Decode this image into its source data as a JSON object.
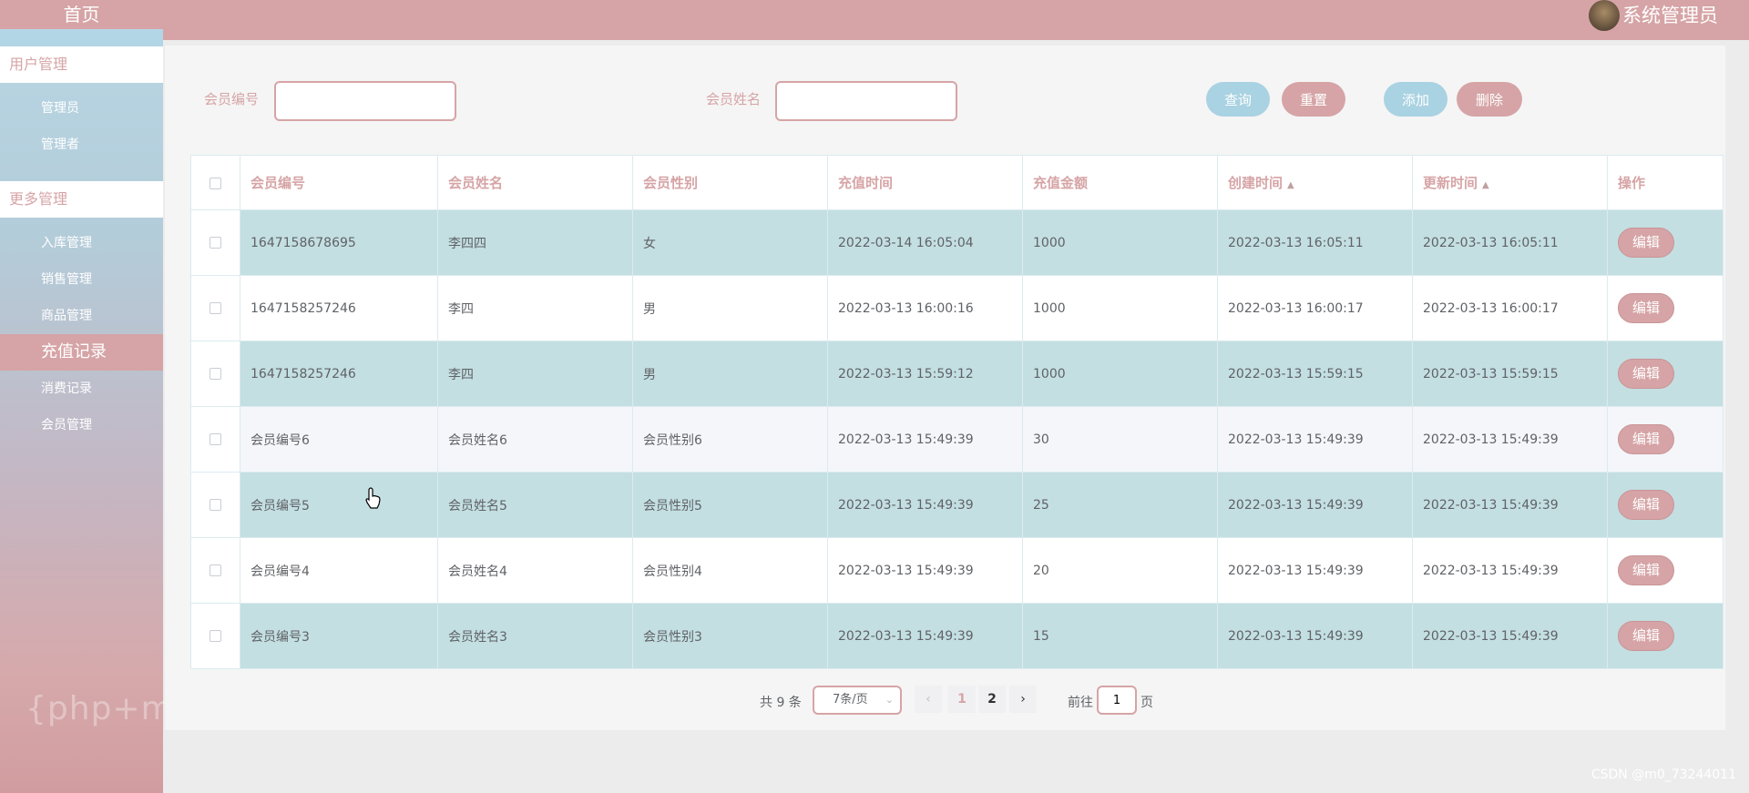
{
  "sidebar": {
    "home": "首页",
    "groups": [
      {
        "label": "用户管理",
        "items": [
          "管理员",
          "管理者"
        ]
      },
      {
        "label": "更多管理",
        "items": [
          "入库管理",
          "销售管理",
          "商品管理",
          "充值记录",
          "消费记录",
          "会员管理"
        ]
      }
    ],
    "active_item": "充值记录",
    "watermark": "{php+mysql}"
  },
  "header": {
    "user_name": "系统管理员"
  },
  "search": {
    "member_no_label": "会员编号",
    "member_name_label": "会员姓名",
    "member_no_value": "",
    "member_name_value": "",
    "query_button": "查询",
    "reset_button": "重置",
    "add_button": "添加",
    "delete_button": "删除"
  },
  "table": {
    "columns": [
      "会员编号",
      "会员姓名",
      "会员性别",
      "充值时间",
      "充值金额",
      "创建时间",
      "更新时间",
      "操作"
    ],
    "edit_label": "编辑",
    "rows": [
      {
        "no": "1647158678695",
        "name": "李四四",
        "gender": "女",
        "recharge_time": "2022-03-14 16:05:04",
        "amount": "1000",
        "created": "2022-03-13 16:05:11",
        "updated": "2022-03-13 16:05:11"
      },
      {
        "no": "1647158257246",
        "name": "李四",
        "gender": "男",
        "recharge_time": "2022-03-13 16:00:16",
        "amount": "1000",
        "created": "2022-03-13 16:00:17",
        "updated": "2022-03-13 16:00:17"
      },
      {
        "no": "1647158257246",
        "name": "李四",
        "gender": "男",
        "recharge_time": "2022-03-13 15:59:12",
        "amount": "1000",
        "created": "2022-03-13 15:59:15",
        "updated": "2022-03-13 15:59:15"
      },
      {
        "no": "会员编号6",
        "name": "会员姓名6",
        "gender": "会员性别6",
        "recharge_time": "2022-03-13 15:49:39",
        "amount": "30",
        "created": "2022-03-13 15:49:39",
        "updated": "2022-03-13 15:49:39"
      },
      {
        "no": "会员编号5",
        "name": "会员姓名5",
        "gender": "会员性别5",
        "recharge_time": "2022-03-13 15:49:39",
        "amount": "25",
        "created": "2022-03-13 15:49:39",
        "updated": "2022-03-13 15:49:39"
      },
      {
        "no": "会员编号4",
        "name": "会员姓名4",
        "gender": "会员性别4",
        "recharge_time": "2022-03-13 15:49:39",
        "amount": "20",
        "created": "2022-03-13 15:49:39",
        "updated": "2022-03-13 15:49:39"
      },
      {
        "no": "会员编号3",
        "name": "会员姓名3",
        "gender": "会员性别3",
        "recharge_time": "2022-03-13 15:49:39",
        "amount": "15",
        "created": "2022-03-13 15:49:39",
        "updated": "2022-03-13 15:49:39"
      }
    ]
  },
  "pagination": {
    "total": "共 9 条",
    "page_size": "7条/页",
    "pages": [
      "1",
      "2"
    ],
    "current_page": "1",
    "goto_label": "前往",
    "goto_value": "1",
    "page_suffix": "页"
  },
  "footer": {
    "credit": "CSDN @m0_73244011"
  },
  "colors": {
    "accent_pink": "#d6a4a6",
    "accent_blue": "#a9d2e2",
    "row_teal": "#c3dfe2"
  }
}
